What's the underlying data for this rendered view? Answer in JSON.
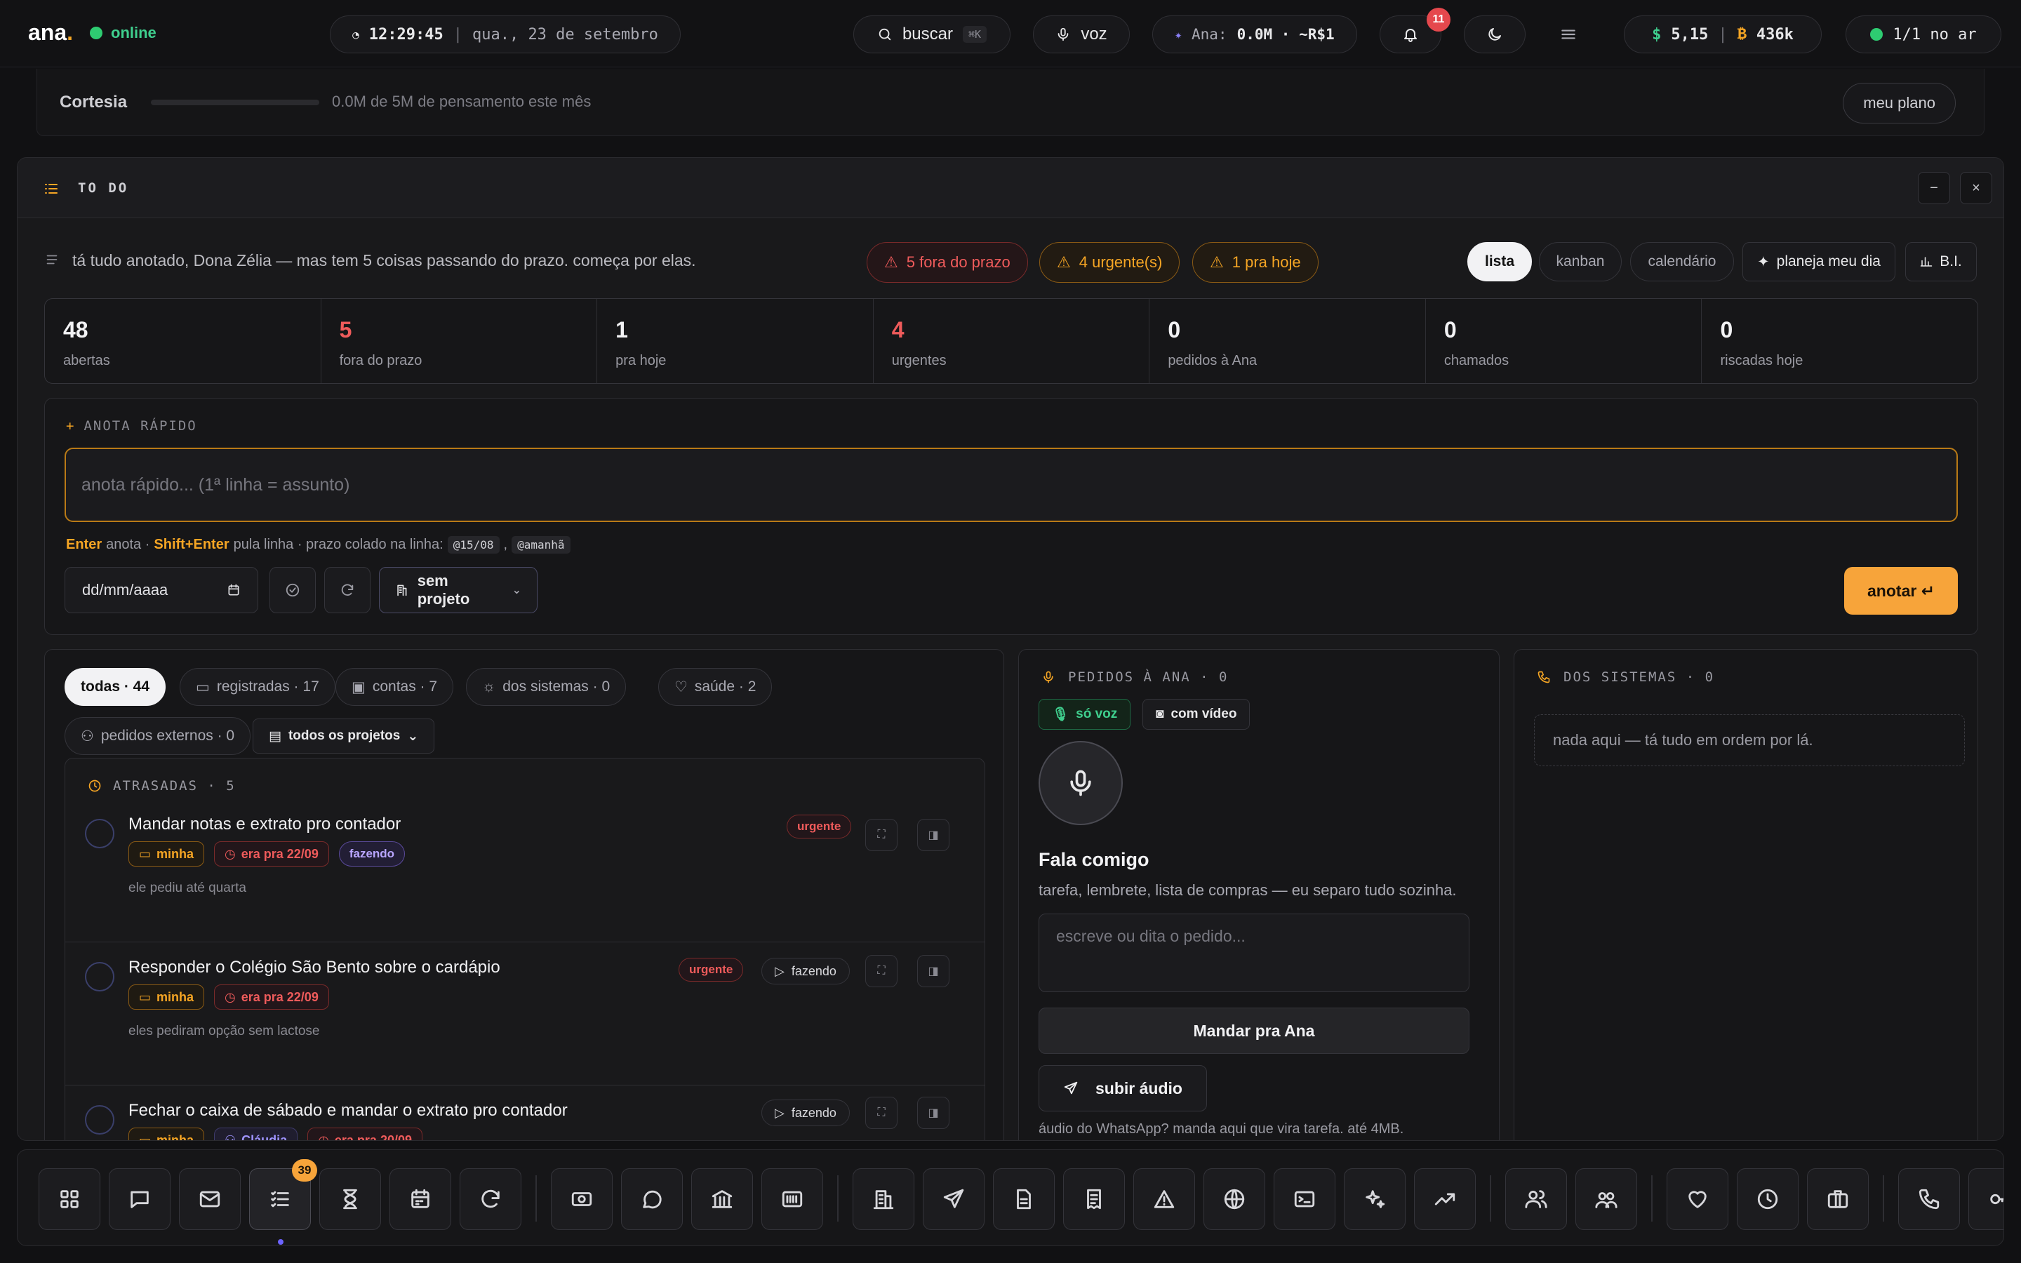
{
  "topbar": {
    "logo": "ana",
    "logo_dot": ".",
    "status": "online",
    "time": "12:29:45",
    "separator": "|",
    "date": "qua., 23 de setembro",
    "search_label": "buscar",
    "search_shortcut": "⌘K",
    "voice_label": "voz",
    "ana_label": "Ana:",
    "ana_usage": "0.0M · ~R$1",
    "notifications_count": "11",
    "balance": "5,15",
    "tokens": "436k",
    "online_count": "1/1 no ar"
  },
  "plan": {
    "name": "Cortesia",
    "usage_text": "0.0M de 5M de pensamento este mês",
    "button": "meu plano",
    "progress_fraction": 0
  },
  "panel": {
    "title": "TO DO",
    "minimize": "−",
    "close": "×",
    "banner": "tá tudo anotado, Dona Zélia — mas tem 5 coisas passando do prazo. começa por elas.",
    "alerts": [
      "5 fora do prazo",
      "4 urgente(s)",
      "1 pra hoje"
    ],
    "views": [
      "lista",
      "kanban",
      "calendário"
    ],
    "plan_day": "planeja meu dia",
    "bi": "B.I."
  },
  "stats": [
    {
      "value": "48",
      "label": "abertas",
      "color": "#f2f2f4"
    },
    {
      "value": "5",
      "label": "fora do prazo",
      "color": "#ef5b5b"
    },
    {
      "value": "1",
      "label": "pra hoje",
      "color": "#f2f2f4"
    },
    {
      "value": "4",
      "label": "urgentes",
      "color": "#ef5b5b"
    },
    {
      "value": "0",
      "label": "pedidos à Ana",
      "color": "#f2f2f4"
    },
    {
      "value": "0",
      "label": "chamados",
      "color": "#f2f2f4"
    },
    {
      "value": "0",
      "label": "riscadas hoje",
      "color": "#f2f2f4"
    }
  ],
  "quick": {
    "header": "ANOTA RÁPIDO",
    "placeholder": "anota rápido... (1ª linha = assunto)",
    "hint_enter": "Enter",
    "hint_anota": "anota ·",
    "hint_shift": "Shift+Enter",
    "hint_rest": "pula linha · prazo colado na linha:",
    "hint_code1": "@15/08",
    "hint_comma": ",",
    "hint_code2": "@amanhã",
    "date_placeholder": "dd/mm/aaaa",
    "project": "sem projeto",
    "submit": "anotar ↵"
  },
  "filters": {
    "pills": [
      "todas · 44",
      "registradas · 17",
      "contas · 7",
      "dos sistemas · 0",
      "saúde · 2"
    ],
    "external": "pedidos externos · 0",
    "projects": "todos os projetos"
  },
  "overdue": {
    "header": "ATRASADAS · 5",
    "tasks": [
      {
        "title": "Mandar notas e extrato pro contador",
        "mine": "minha",
        "late": "era pra 22/09",
        "status": "fazendo",
        "note": "ele pediu até quarta",
        "urgent": "urgente"
      },
      {
        "title": "Responder o Colégio São Bento sobre o cardápio",
        "mine": "minha",
        "late": "era pra 22/09",
        "note": "eles pediram opção sem lactose",
        "urgent": "urgente",
        "action": "fazendo"
      },
      {
        "title": "Fechar o caixa de sábado e mandar o extrato pro contador",
        "mine": "minha",
        "person": "Cláudia",
        "late": "era pra 20/09",
        "action": "fazendo"
      }
    ]
  },
  "ana": {
    "header": "PEDIDOS À ANA · 0",
    "tab_voice": "só voz",
    "tab_video": "com vídeo",
    "title": "Fala comigo",
    "subtitle": "tarefa, lembrete, lista de compras — eu separo tudo sozinha.",
    "placeholder": "escreve ou dita o pedido...",
    "send": "Mandar pra Ana",
    "upload": "subir áudio",
    "note": "áudio do WhatsApp? manda aqui que vira tarefa. até 4MB."
  },
  "systems": {
    "header": "DOS SISTEMAS · 0",
    "empty": "nada aqui — tá tudo em ordem por lá."
  },
  "dock": {
    "badge": "39",
    "icons": [
      "grid-icon",
      "chat-icon",
      "mail-icon",
      "todo-icon",
      "hourglass-icon",
      "calendar-icon",
      "refresh-icon",
      "cash-icon",
      "whatsapp-icon",
      "bank-icon",
      "barcode-icon",
      "building-icon",
      "send-icon",
      "document-icon",
      "receipt-icon",
      "warning-icon",
      "globe-icon",
      "terminal-icon",
      "sparkles-icon",
      "chart-icon",
      "users-icon",
      "team-icon",
      "heart-icon",
      "clock-icon",
      "briefcase-icon",
      "phone-icon",
      "key-icon"
    ]
  },
  "colors": {
    "accent": "#f7a43a",
    "danger": "#ef5b5b",
    "success": "#2ecc71",
    "background": "#111113"
  }
}
